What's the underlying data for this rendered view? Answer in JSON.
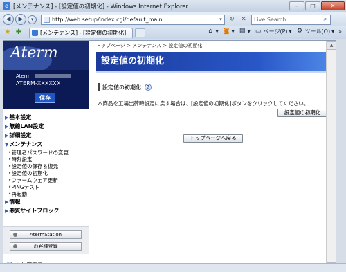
{
  "window": {
    "title": "[メンテナンス] - [設定値の初期化] - Windows Internet Explorer",
    "minimize": "–",
    "maximize": "□",
    "close": "✕"
  },
  "address": {
    "url": "http://web.setup/index.cgi/default_main",
    "search_placeholder": "Live Search"
  },
  "tab": {
    "label": "[メンテナンス] - [設定値の初期化]"
  },
  "commands": {
    "page": "ページ(P)",
    "tools": "ツール(O)"
  },
  "sidebar": {
    "logo": "Aterm",
    "model_prefix": "Aterm",
    "device_name": "ATERM-XXXXXX",
    "save_button": "保存",
    "menu": [
      {
        "label": "基本設定"
      },
      {
        "label": "無線LAN設定"
      },
      {
        "label": "詳細設定"
      },
      {
        "label": "メンテナンス",
        "children": [
          "管理者パスワードの変更",
          "時刻設定",
          "設定値の保存＆復元",
          "設定値の初期化",
          "ファームウェア更新",
          "PINGテスト",
          "再起動"
        ]
      },
      {
        "label": "情報"
      },
      {
        "label": "悪質サイトブロック"
      }
    ],
    "aterm_station_button": "AtermStation",
    "register_button": "お客様登録",
    "help_label": "ヘルプ表示"
  },
  "main": {
    "breadcrumb": "トップページ > メンテナンス > 設定値の初期化",
    "heading": "設定値の初期化",
    "section_title": "設定値の初期化",
    "description": "本商品を工場出荷時設定に戻す場合は、[設定値の初期化]ボタンをクリックしてください。",
    "init_button": "設定値の初期化",
    "back_button": "トップページへ戻る"
  }
}
